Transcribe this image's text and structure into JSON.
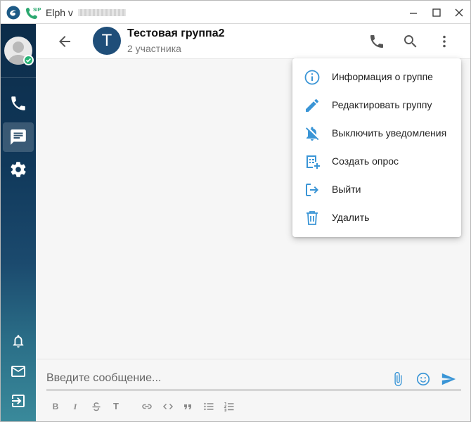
{
  "window": {
    "title": "Elph v",
    "controls": [
      "minimize-icon",
      "maximize-icon",
      "close-icon"
    ]
  },
  "sidebar": {
    "items": [
      {
        "name": "calls",
        "icon": "phone-icon"
      },
      {
        "name": "chats",
        "icon": "chat-icon",
        "active": true
      },
      {
        "name": "settings",
        "icon": "gear-icon"
      },
      {
        "name": "notifications",
        "icon": "bell-icon"
      },
      {
        "name": "mail",
        "icon": "mail-icon"
      },
      {
        "name": "logout",
        "icon": "logout-icon"
      }
    ]
  },
  "header": {
    "avatar_letter": "T",
    "group_name": "Тестовая группа2",
    "members": "2 участника",
    "actions": [
      "phone-icon",
      "search-icon",
      "more-vert-icon"
    ]
  },
  "menu": {
    "items": [
      {
        "label": "Информация о группе",
        "icon": "info-icon"
      },
      {
        "label": "Редактировать группу",
        "icon": "pencil-icon"
      },
      {
        "label": "Выключить уведомления",
        "icon": "bell-off-icon"
      },
      {
        "label": "Создать опрос",
        "icon": "poll-add-icon"
      },
      {
        "label": "Выйти",
        "icon": "exit-icon"
      },
      {
        "label": "Удалить",
        "icon": "trash-icon"
      }
    ]
  },
  "composer": {
    "placeholder": "Введите сообщение...",
    "format_tools": [
      "bold",
      "italic",
      "strikethrough",
      "heading",
      "link",
      "code",
      "quote",
      "bullet-list",
      "numbered-list"
    ],
    "bold_glyph": "B",
    "italic_glyph": "I",
    "heading_glyph": "T"
  },
  "colors": {
    "accent": "#3a95d6",
    "sidebar_top": "#0c2c49",
    "sidebar_bottom": "#3a8a9b",
    "group_avatar": "#1f4e79",
    "online": "#27b376"
  }
}
